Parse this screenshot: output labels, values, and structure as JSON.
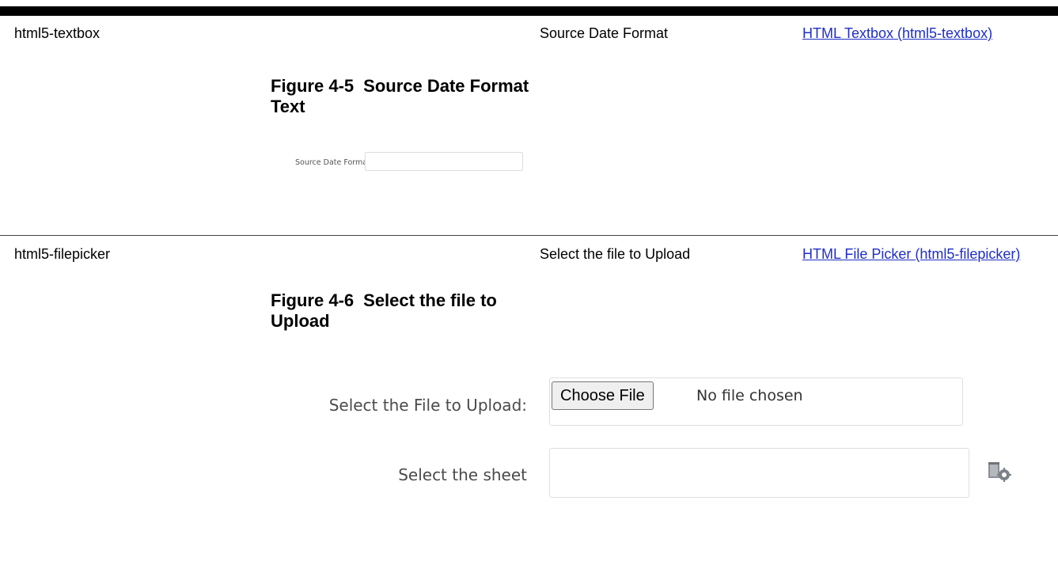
{
  "rows": [
    {
      "name": "html5-textbox",
      "label": "Source Date Format",
      "link": "HTML Textbox (html5-textbox)",
      "figure": {
        "number": "Figure 4-5",
        "title": "Source Date Format Text",
        "field_label": "Source Date Format",
        "field_value": ""
      }
    },
    {
      "name": "html5-filepicker",
      "label": "Select the file to Upload",
      "link": "HTML File Picker (html5-filepicker)",
      "figure": {
        "number": "Figure 4-6",
        "title": "Select the file to Upload",
        "file_label": "Select the File to Upload:",
        "choose_button": "Choose File",
        "no_file_text": "No file chosen",
        "sheet_label": "Select the sheet",
        "sheet_value": "",
        "sheet_icon": "settings-sheet-icon"
      }
    }
  ],
  "colors": {
    "link": "#1f2fc2",
    "rule": "#000000"
  }
}
